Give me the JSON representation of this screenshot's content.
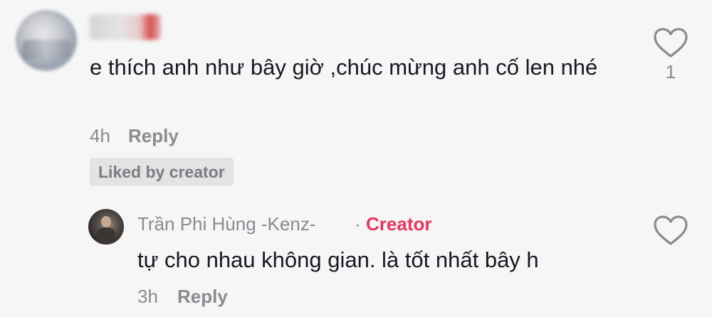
{
  "comment": {
    "text": "e thích anh như bây giờ ,chúc mừng anh cố len nhé",
    "time": "4h",
    "reply_label": "Reply",
    "liked_badge": "Liked by creator",
    "like_count": "1",
    "like_icon": "heart-outline-icon"
  },
  "reply": {
    "author": "Trần Phi Hùng -Kenz-",
    "separator": "·",
    "role_badge": "Creator",
    "text": "tự cho nhau không gian. là tốt nhất bây h",
    "time": "3h",
    "reply_label": "Reply",
    "like_icon": "heart-outline-icon"
  },
  "colors": {
    "background": "#f6f6f6",
    "text_primary": "#161823",
    "text_secondary": "#8a8b91",
    "creator_accent": "#e8365e"
  }
}
